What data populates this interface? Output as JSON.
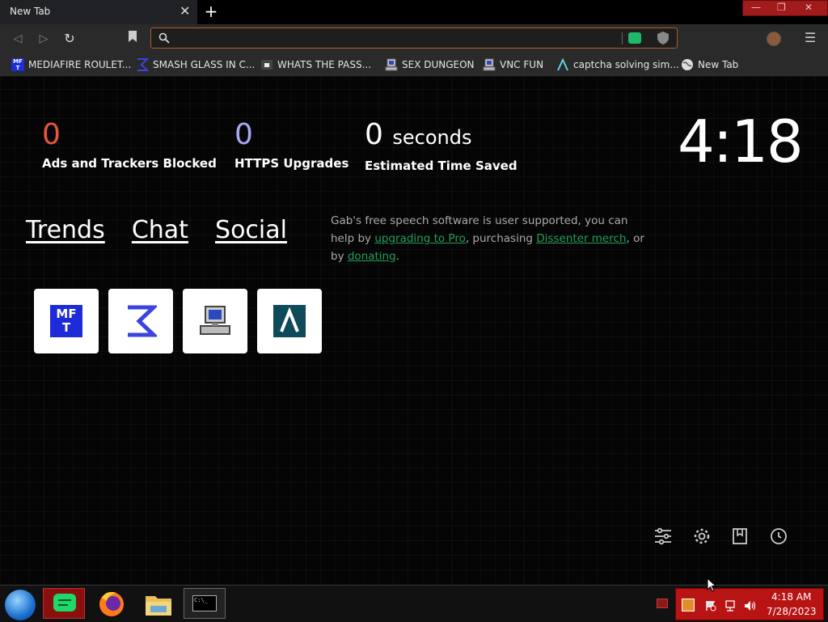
{
  "tab": {
    "title": "New Tab",
    "close": "✕",
    "new_tab": "+"
  },
  "window_controls": {
    "minimize": "—",
    "restore": "❐",
    "close": "✕"
  },
  "toolbar": {
    "back": "◁",
    "forward": "▷",
    "reload": "↻",
    "address_value": "",
    "address_placeholder": "",
    "menu": "☰"
  },
  "bookmarks": [
    {
      "label": "MEDIAFIRE ROULET...",
      "icon": "mft-icon"
    },
    {
      "label": "SMASH GLASS IN C...",
      "icon": "sigma-icon"
    },
    {
      "label": "WHATS THE PASS...",
      "icon": "password-icon"
    },
    {
      "label": "SEX DUNGEON",
      "icon": "vnc-computer-icon"
    },
    {
      "label": "VNC FUN",
      "icon": "vnc-computer-icon"
    },
    {
      "label": "captcha solving sim...",
      "icon": "lambda-icon"
    },
    {
      "label": "New Tab",
      "icon": "globe-icon"
    }
  ],
  "stats": {
    "ads": {
      "value": "0",
      "label": "Ads and Trackers Blocked",
      "color": "#e8553a"
    },
    "https": {
      "value": "0",
      "label": "HTTPS Upgrades",
      "color": "#a8a8f0"
    },
    "time": {
      "value": "0",
      "unit": "seconds",
      "label": "Estimated Time Saved",
      "color": "#ffffff"
    }
  },
  "clock": "4:18",
  "nav_links": {
    "trends": "Trends",
    "chat": "Chat",
    "social": "Social"
  },
  "gab_message": {
    "part1": "Gab's free speech software is user supported, you can help by ",
    "link1": "upgrading to Pro",
    "part2": ", purchasing ",
    "link2": "Dissenter merch",
    "part3": ", or by ",
    "link3": "donating",
    "part4": "."
  },
  "top_sites": [
    {
      "name": "mediafire-roulette",
      "icon": "mft-icon",
      "text": "MF\nT"
    },
    {
      "name": "smash-glass",
      "icon": "sigma-icon"
    },
    {
      "name": "vnc",
      "icon": "vnc-computer-icon"
    },
    {
      "name": "captcha",
      "icon": "lambda-icon"
    }
  ],
  "taskbar": {
    "time": "4:18 AM",
    "date": "7/28/2023",
    "terminal_label": "C:\\_"
  },
  "colors": {
    "accent_green": "#1fb86a",
    "tray_red": "#b81414",
    "orange_stat": "#e8553a",
    "purple_stat": "#a8a8f0"
  }
}
